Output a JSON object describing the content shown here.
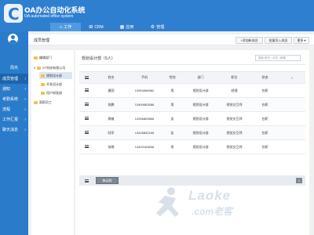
{
  "app": {
    "title": "OA办公自动化系统",
    "subtitle": "OA automated office system"
  },
  "topnav": [
    {
      "label": "工作",
      "icon": "home-icon",
      "active": true
    },
    {
      "label": "CRM",
      "icon": "grid-icon",
      "active": false
    },
    {
      "label": "应用",
      "icon": "apps-icon",
      "active": false
    },
    {
      "label": "管理",
      "icon": "gear-icon",
      "active": false
    }
  ],
  "user": {
    "name": "周杰"
  },
  "sidebar": {
    "items": [
      {
        "label": "成员管理",
        "active": true
      },
      {
        "label": "通知",
        "active": false
      },
      {
        "label": "考勤系统",
        "active": false
      },
      {
        "label": "流程",
        "active": false
      },
      {
        "label": "工作汇报",
        "active": false
      },
      {
        "label": "聊天消息",
        "active": false
      }
    ]
  },
  "toolbar": {
    "page_title": "成员管理",
    "add_member": "+添加新成员",
    "batch_import": "批量导入成员",
    "more": "更多 ▾"
  },
  "tree": {
    "items": [
      {
        "label": "编辑部门"
      },
      {
        "label": "XT科技有限公司"
      },
      {
        "label": "规划设计部"
      },
      {
        "label": "开发设计部"
      },
      {
        "label": "用户研发部"
      },
      {
        "label": "离职员工"
      }
    ]
  },
  "content": {
    "dept_title": "规划设计部（5人）",
    "search_placeholder": "搜索 账号 / 手机 / 邮箱",
    "columns": [
      "",
      "姓名",
      "手机",
      "性别",
      "部门",
      "职位",
      "状态",
      "+"
    ],
    "rows": [
      {
        "name": "唐园",
        "phone": "13904566982",
        "gender": "男",
        "dept": "规划设计部",
        "position": "经理",
        "status": "在职"
      },
      {
        "name": "张鹏",
        "phone": "13494563586",
        "gender": "男",
        "dept": "规划设计部",
        "position": "视觉交互师",
        "status": "在职"
      },
      {
        "name": "周敏",
        "phone": "13256863866",
        "gender": "女",
        "dept": "规划设计部",
        "position": "视觉交互师",
        "status": "在职"
      },
      {
        "name": "陆军",
        "phone": "13426892165",
        "gender": "女",
        "dept": "规划设计部",
        "position": "视觉交互师",
        "status": "在职"
      },
      {
        "name": "张晓",
        "phone": "13420183836",
        "gender": "男",
        "dept": "规划设计部",
        "position": "视觉交互师",
        "status": "在职"
      }
    ],
    "pager_button": "移动到",
    "current_page": "1"
  },
  "watermark": {
    "word": "Laoke",
    "url": ".com老客"
  },
  "colors": {
    "brand": "#2f7fd0",
    "sidebar": "#2a7ccb",
    "sidebar_active": "#1c65ad"
  }
}
